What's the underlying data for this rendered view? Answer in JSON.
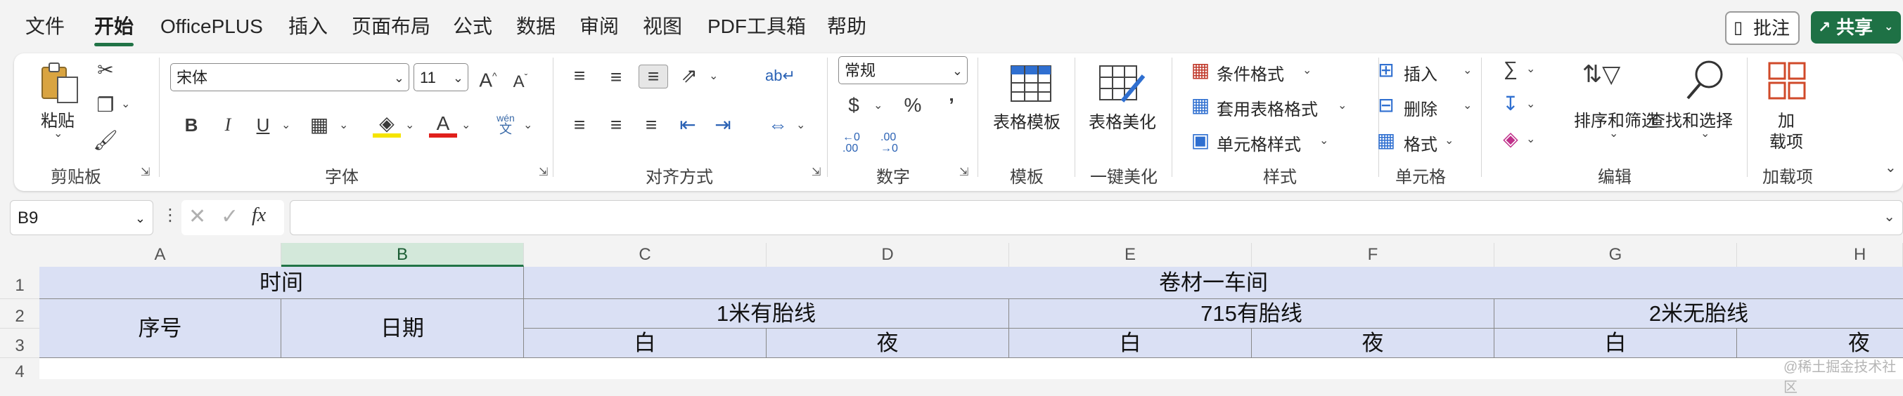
{
  "menu": {
    "tabs": [
      "文件",
      "开始",
      "OfficePLUS",
      "插入",
      "页面布局",
      "公式",
      "数据",
      "审阅",
      "视图",
      "PDF工具箱",
      "帮助"
    ],
    "comment_label": "批注",
    "share_label": "共享"
  },
  "ribbon": {
    "clipboard": {
      "paste_label": "粘贴",
      "group": "剪贴板"
    },
    "font": {
      "family": "宋体",
      "size": "11",
      "group": "字体",
      "bold": "B",
      "italic": "I",
      "underline": "U",
      "phonetic_top": "wén",
      "phonetic_bottom": "文"
    },
    "alignment": {
      "group": "对齐方式"
    },
    "number": {
      "format": "常规",
      "group": "数字"
    },
    "template": {
      "label": "表格模板",
      "group": "模板"
    },
    "beautify": {
      "label": "表格美化",
      "group": "一键美化"
    },
    "styles": {
      "conditional": "条件格式",
      "table_format": "套用表格格式",
      "cell_styles": "单元格样式",
      "group": "样式"
    },
    "cells": {
      "insert": "插入",
      "delete": "删除",
      "format": "格式",
      "group": "单元格"
    },
    "editing": {
      "sort_filter": "排序和筛选",
      "find_select": "查找和选择",
      "group": "编辑"
    },
    "addins": {
      "label_top": "加",
      "label_bottom": "载项",
      "group": "加载项"
    }
  },
  "formula_bar": {
    "name_box": "B9",
    "fx": "fx",
    "formula": ""
  },
  "sheet": {
    "columns": [
      "A",
      "B",
      "C",
      "D",
      "E",
      "F",
      "G",
      "H"
    ],
    "selected_column": "B",
    "rows": [
      "1",
      "2",
      "3",
      "4"
    ],
    "cells": {
      "time": "时间",
      "workshop": "卷材一车间",
      "seq": "序号",
      "date": "日期",
      "line1": "1米有胎线",
      "line2": "715有胎线",
      "line3": "2米无胎线",
      "day": "白",
      "night": "夜"
    }
  },
  "watermark": "@稀土掘金技术社区",
  "colors": {
    "accent": "#217346",
    "header_fill": "#dae0f4",
    "share_bg": "#1e7145"
  }
}
